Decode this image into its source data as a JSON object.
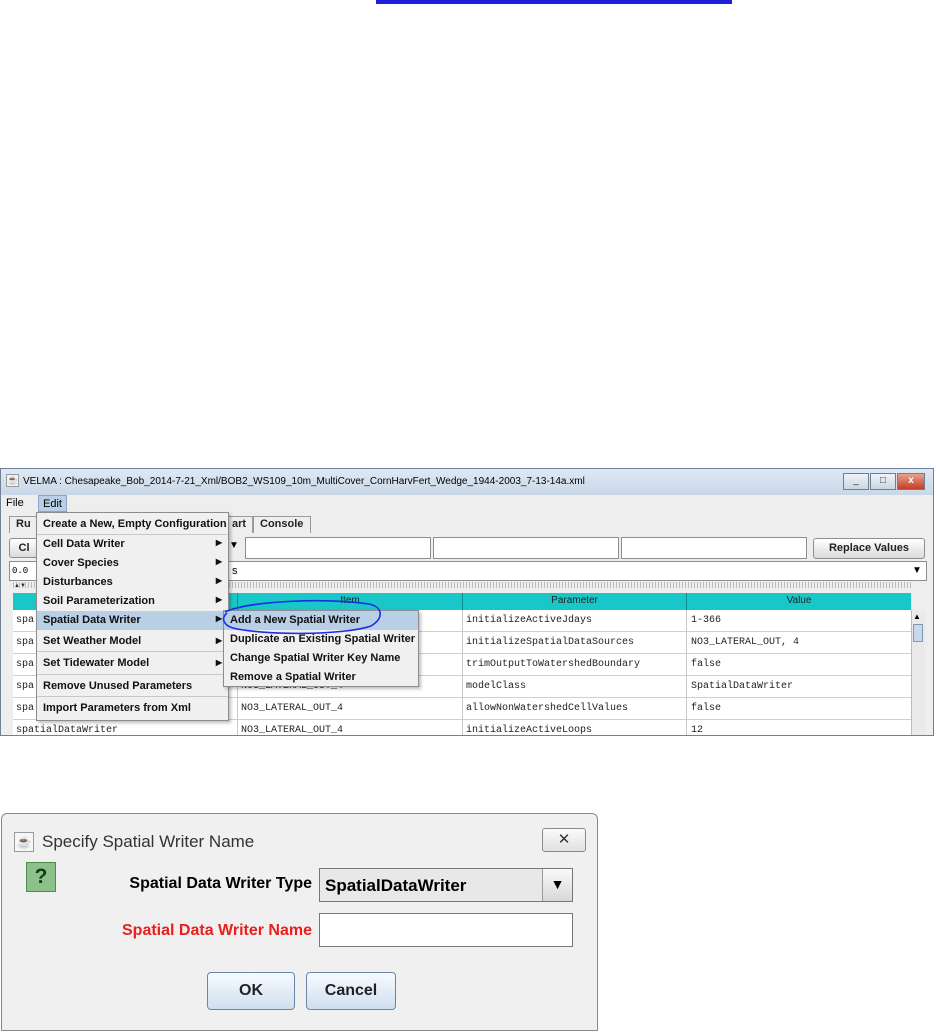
{
  "window": {
    "title": "VELMA : Chesapeake_Bob_2014-7-21_Xml/BOB2_WS109_10m_MultiCover_CornHarvFert_Wedge_1944-2003_7-13-14a.xml",
    "controls": [
      "_",
      "□",
      "x"
    ]
  },
  "menubar": {
    "file": "File",
    "edit": "Edit"
  },
  "tabs": [
    "Ru",
    "art",
    "Console"
  ],
  "toolbar": {
    "left_btn": "Cl",
    "replace_btn": "Replace Values",
    "dropdown_arrow": "▼"
  },
  "row2": {
    "left_text": "0.0",
    "mid_text": "s",
    "arrow": "▼",
    "tiny": "▲▼"
  },
  "table": {
    "headers": [
      "Item",
      "Parameter",
      "Value"
    ],
    "rows": [
      {
        "c0": "spa",
        "c1": "",
        "c2": "initializeActiveJdays",
        "c3": "1-366"
      },
      {
        "c0": "spa",
        "c1": "",
        "c2": "initializeSpatialDataSources",
        "c3": "NO3_LATERAL_OUT, 4"
      },
      {
        "c0": "spa",
        "c1": "",
        "c2": "trimOutputToWatershedBoundary",
        "c3": "false"
      },
      {
        "c0": "spa",
        "c1": "NO3_LATERAL_OUT_4",
        "c2": "modelClass",
        "c3": "SpatialDataWriter"
      },
      {
        "c0": "spa",
        "c1": "NO3_LATERAL_OUT_4",
        "c2": "allowNonWatershedCellValues",
        "c3": "false"
      },
      {
        "c0": "spatialDataWriter",
        "c1": "NO3_LATERAL_OUT_4",
        "c2": "initializeActiveLoops",
        "c3": "12"
      }
    ]
  },
  "edit_menu": {
    "items": [
      {
        "label": "Create a New, Empty Configuration",
        "submenu": false
      },
      {
        "label": "Cell Data Writer",
        "submenu": true
      },
      {
        "label": "Cover Species",
        "submenu": true
      },
      {
        "label": "Disturbances",
        "submenu": true
      },
      {
        "label": "Soil Parameterization",
        "submenu": true
      },
      {
        "label": "Spatial Data Writer",
        "submenu": true
      },
      {
        "label": "Set Weather Model",
        "submenu": true
      },
      {
        "label": "Set Tidewater Model",
        "submenu": true
      },
      {
        "label": "Remove Unused Parameters",
        "submenu": false
      },
      {
        "label": "Import Parameters from Xml",
        "submenu": false
      }
    ],
    "submenu_arrow": "▶"
  },
  "spatial_submenu": {
    "items": [
      "Add a New Spatial Writer",
      "Duplicate an Existing Spatial Writer",
      "Change Spatial Writer Key Name",
      "Remove a Spatial Writer"
    ]
  },
  "dialog": {
    "title": "Specify Spatial Writer Name",
    "close_glyph": "✕",
    "question_glyph": "?",
    "type_label": "Spatial Data Writer Type",
    "type_value": "SpatialDataWriter",
    "type_arrow": "▼",
    "name_label": "Spatial Data Writer Name",
    "name_value": "",
    "ok": "OK",
    "cancel": "Cancel",
    "name_label_color": "#e8201d"
  },
  "annotation_color": "#1a2ee8",
  "app_icon_glyph": "☕"
}
